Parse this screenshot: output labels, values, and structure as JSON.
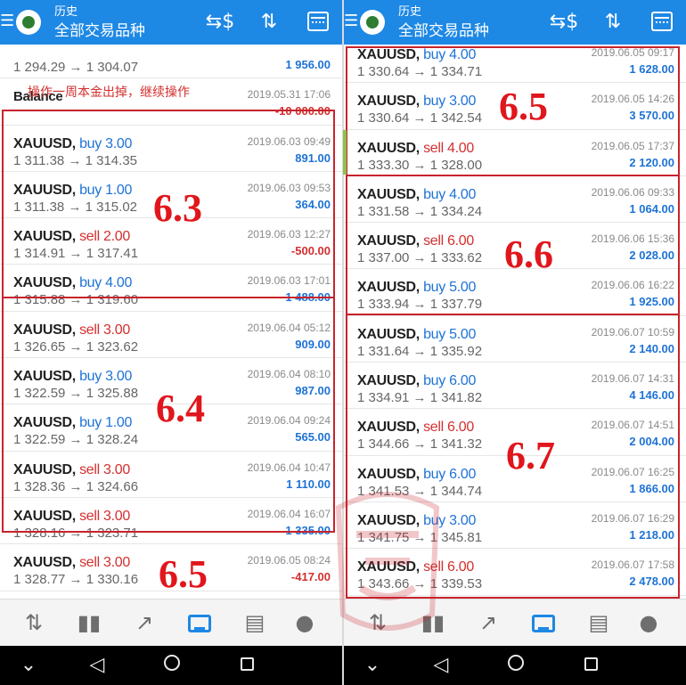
{
  "header": {
    "title": "历史",
    "subtitle": "全部交易品种",
    "menu_icon": "hamburger-icon",
    "dollar_icon": "currency-swap-icon",
    "sort_icon": "sort-arrows-icon",
    "calendar_icon": "calendar-icon"
  },
  "annotation_note": "操作一周本金出掉，继续操作",
  "group_labels": {
    "l1": "6.3",
    "l2": "6.4",
    "l3": "6.5",
    "r1": "6.5",
    "r2": "6.6",
    "r3": "6.7"
  },
  "left_rows": [
    {
      "symbol": "",
      "side": "",
      "prices": "1 294.29 → 1 304.07",
      "date": "",
      "profit": "1 956.00",
      "sign": "pos"
    },
    {
      "symbol": "Balance",
      "side": "",
      "prices": "",
      "date": "2019.05.31 17:06",
      "profit": "-10 000.00",
      "sign": "neg"
    },
    {
      "symbol": "XAUUSD,",
      "side": "buy 3.00",
      "prices": "1 311.38 → 1 314.35",
      "date": "2019.06.03 09:49",
      "profit": "891.00",
      "sign": "pos"
    },
    {
      "symbol": "XAUUSD,",
      "side": "buy 1.00",
      "prices": "1 311.38 → 1 315.02",
      "date": "2019.06.03 09:53",
      "profit": "364.00",
      "sign": "pos"
    },
    {
      "symbol": "XAUUSD,",
      "side": "sell 2.00",
      "prices": "1 314.91 → 1 317.41",
      "date": "2019.06.03 12:27",
      "profit": "-500.00",
      "sign": "neg"
    },
    {
      "symbol": "XAUUSD,",
      "side": "buy 4.00",
      "prices": "1 315.88 → 1 319.60",
      "date": "2019.06.03 17:01",
      "profit": "1 488.00",
      "sign": "pos"
    },
    {
      "symbol": "XAUUSD,",
      "side": "sell 3.00",
      "prices": "1 326.65 → 1 323.62",
      "date": "2019.06.04 05:12",
      "profit": "909.00",
      "sign": "pos"
    },
    {
      "symbol": "XAUUSD,",
      "side": "buy 3.00",
      "prices": "1 322.59 → 1 325.88",
      "date": "2019.06.04 08:10",
      "profit": "987.00",
      "sign": "pos"
    },
    {
      "symbol": "XAUUSD,",
      "side": "buy 1.00",
      "prices": "1 322.59 → 1 328.24",
      "date": "2019.06.04 09:24",
      "profit": "565.00",
      "sign": "pos"
    },
    {
      "symbol": "XAUUSD,",
      "side": "sell 3.00",
      "prices": "1 328.36 → 1 324.66",
      "date": "2019.06.04 10:47",
      "profit": "1 110.00",
      "sign": "pos"
    },
    {
      "symbol": "XAUUSD,",
      "side": "sell 3.00",
      "prices": "1 328.16 → 1 323.71",
      "date": "2019.06.04 16:07",
      "profit": "1 335.00",
      "sign": "pos"
    },
    {
      "symbol": "XAUUSD,",
      "side": "sell 3.00",
      "prices": "1 328.77 → 1 330.16",
      "date": "2019.06.05 08:24",
      "profit": "-417.00",
      "sign": "neg"
    },
    {
      "symbol": "XAUUSD,",
      "side": "buy 4.00",
      "prices": "",
      "date": "2019.06.05 09:17",
      "profit": "",
      "sign": "pos"
    }
  ],
  "right_rows": [
    {
      "symbol": "XAUUSD,",
      "side": "buy 4.00",
      "prices": "1 330.64 → 1 334.71",
      "date": "2019.06.05 09:17",
      "profit": "1 628.00",
      "sign": "pos"
    },
    {
      "symbol": "XAUUSD,",
      "side": "buy 3.00",
      "prices": "1 330.64 → 1 342.54",
      "date": "2019.06.05 14:26",
      "profit": "3 570.00",
      "sign": "pos"
    },
    {
      "symbol": "XAUUSD,",
      "side": "sell 4.00",
      "prices": "1 333.30 → 1 328.00",
      "date": "2019.06.05 17:37",
      "profit": "2 120.00",
      "sign": "pos"
    },
    {
      "symbol": "XAUUSD,",
      "side": "buy 4.00",
      "prices": "1 331.58 → 1 334.24",
      "date": "2019.06.06 09:33",
      "profit": "1 064.00",
      "sign": "pos"
    },
    {
      "symbol": "XAUUSD,",
      "side": "sell 6.00",
      "prices": "1 337.00 → 1 333.62",
      "date": "2019.06.06 15:36",
      "profit": "2 028.00",
      "sign": "pos"
    },
    {
      "symbol": "XAUUSD,",
      "side": "buy 5.00",
      "prices": "1 333.94 → 1 337.79",
      "date": "2019.06.06 16:22",
      "profit": "1 925.00",
      "sign": "pos"
    },
    {
      "symbol": "XAUUSD,",
      "side": "buy 5.00",
      "prices": "1 331.64 → 1 335.92",
      "date": "2019.06.07 10:59",
      "profit": "2 140.00",
      "sign": "pos"
    },
    {
      "symbol": "XAUUSD,",
      "side": "buy 6.00",
      "prices": "1 334.91 → 1 341.82",
      "date": "2019.06.07 14:31",
      "profit": "4 146.00",
      "sign": "pos"
    },
    {
      "symbol": "XAUUSD,",
      "side": "sell 6.00",
      "prices": "1 344.66 → 1 341.32",
      "date": "2019.06.07 14:51",
      "profit": "2 004.00",
      "sign": "pos"
    },
    {
      "symbol": "XAUUSD,",
      "side": "buy 6.00",
      "prices": "1 341.53 → 1 344.74",
      "date": "2019.06.07 16:25",
      "profit": "1 866.00",
      "sign": "pos"
    },
    {
      "symbol": "XAUUSD,",
      "side": "buy 3.00",
      "prices": "1 341.75 → 1 345.81",
      "date": "2019.06.07 16:29",
      "profit": "1 218.00",
      "sign": "pos"
    },
    {
      "symbol": "XAUUSD,",
      "side": "sell 6.00",
      "prices": "1 343.66 → 1 339.53",
      "date": "2019.06.07 17:58",
      "profit": "2 478.00",
      "sign": "pos"
    }
  ],
  "bottom_nav": [
    {
      "icon": "quotes-icon",
      "glyph": "⇅"
    },
    {
      "icon": "chart-icon",
      "glyph": "▮▮"
    },
    {
      "icon": "trade-icon",
      "glyph": "↗"
    },
    {
      "icon": "history-icon",
      "glyph": ""
    },
    {
      "icon": "news-icon",
      "glyph": "▤"
    },
    {
      "icon": "messages-icon",
      "glyph": "●"
    }
  ],
  "system_nav": {
    "down": "⌄",
    "back": "◁"
  },
  "colors": {
    "header_bg": "#1e88e5",
    "buy": "#1e73d6",
    "sell": "#d32f2f",
    "annotation": "#c8232c"
  }
}
